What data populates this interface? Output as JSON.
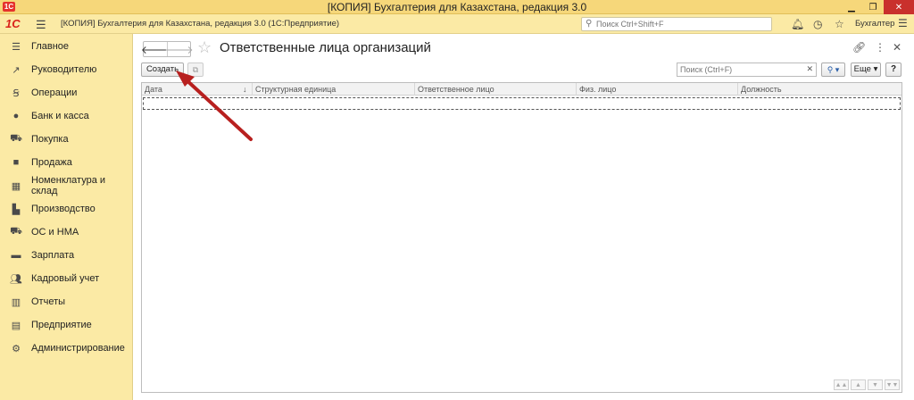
{
  "window": {
    "title": "[КОПИЯ] Бухгалтерия для Казахстана, редакция 3.0",
    "logo": "1С"
  },
  "toolbar": {
    "logo": "1С",
    "subtitle": "[КОПИЯ] Бухгалтерия для Казахстана, редакция 3.0  (1С:Предприятие)",
    "search_placeholder": "Поиск Ctrl+Shift+F",
    "user": "Бухгалтер"
  },
  "sidebar": {
    "items": [
      {
        "label": "Главное",
        "icon": "list-icon"
      },
      {
        "label": "Руководителю",
        "icon": "trend-icon"
      },
      {
        "label": "Операции",
        "icon": "operations-icon"
      },
      {
        "label": "Банк и касса",
        "icon": "money-icon"
      },
      {
        "label": "Покупка",
        "icon": "cart-icon"
      },
      {
        "label": "Продажа",
        "icon": "bag-icon"
      },
      {
        "label": "Номенклатура и склад",
        "icon": "grid-icon"
      },
      {
        "label": "Производство",
        "icon": "factory-icon"
      },
      {
        "label": "ОС и НМА",
        "icon": "truck-icon"
      },
      {
        "label": "Зарплата",
        "icon": "wallet-icon"
      },
      {
        "label": "Кадровый учет",
        "icon": "people-icon"
      },
      {
        "label": "Отчеты",
        "icon": "chart-icon"
      },
      {
        "label": "Предприятие",
        "icon": "building-icon"
      },
      {
        "label": "Администрирование",
        "icon": "gear-icon"
      }
    ]
  },
  "main": {
    "title": "Ответственные лица организаций",
    "create_label": "Создать",
    "search_placeholder": "Поиск (Ctrl+F)",
    "more_label": "Еще",
    "help_label": "?",
    "columns": [
      "Дата",
      "Структурная единица",
      "Ответственное лицо",
      "Физ. лицо",
      "Должность"
    ]
  }
}
